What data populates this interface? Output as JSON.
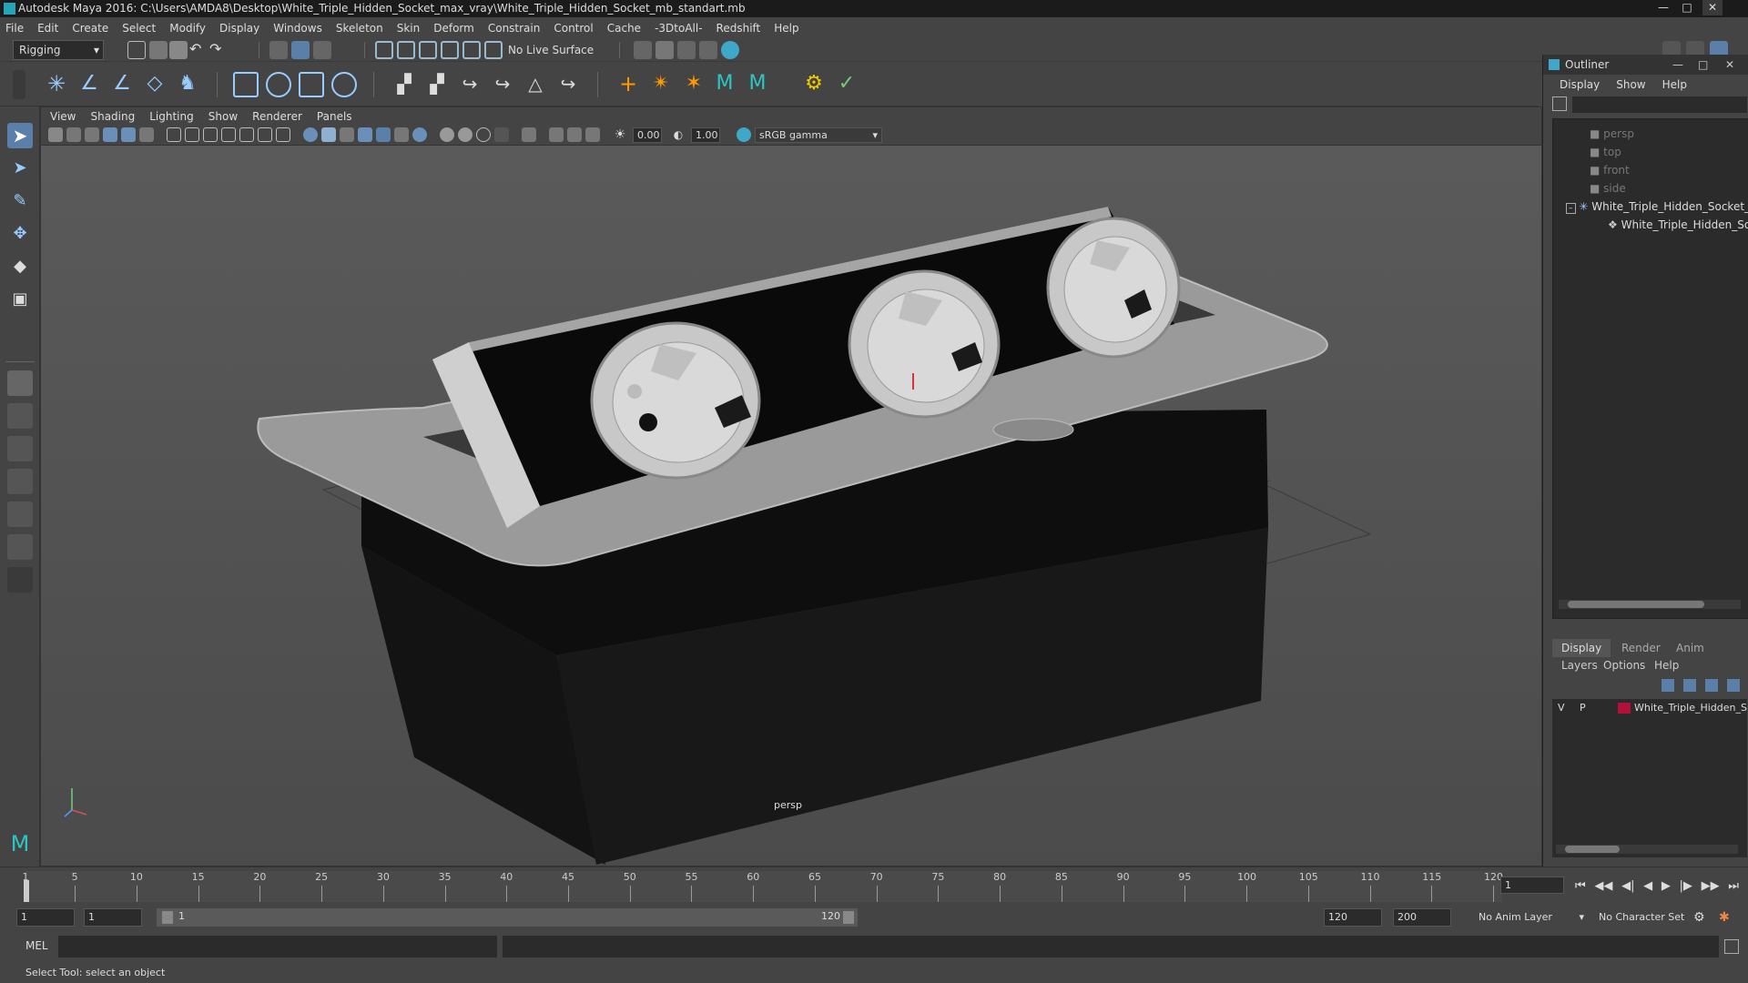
{
  "window": {
    "title": "Autodesk Maya 2016: C:\\Users\\AMDA8\\Desktop\\White_Triple_Hidden_Socket_max_vray\\White_Triple_Hidden_Socket_mb_standart.mb"
  },
  "menubar": [
    "File",
    "Edit",
    "Create",
    "Select",
    "Modify",
    "Display",
    "Windows",
    "Skeleton",
    "Skin",
    "Deform",
    "Constrain",
    "Control",
    "Cache",
    "-3DtoAll-",
    "Redshift",
    "Help"
  ],
  "shelf": {
    "mode": "Rigging",
    "live_surface": "No Live Surface"
  },
  "viewport": {
    "menu": [
      "View",
      "Shading",
      "Lighting",
      "Show",
      "Renderer",
      "Panels"
    ],
    "exposure": "0.00",
    "gamma": "1.00",
    "color_space": "sRGB gamma",
    "camera_label": "persp"
  },
  "outliner": {
    "title": "Outliner",
    "menu": [
      "Display",
      "Show",
      "Help"
    ],
    "items": [
      {
        "label": "persp"
      },
      {
        "label": "top"
      },
      {
        "label": "front"
      },
      {
        "label": "side"
      },
      {
        "label": "White_Triple_Hidden_Socket_"
      },
      {
        "label": "White_Triple_Hidden_Soc"
      }
    ]
  },
  "layers": {
    "tabs": [
      "Display",
      "Render",
      "Anim"
    ],
    "menu": [
      "Layers",
      "Options",
      "Help"
    ],
    "row": {
      "v": "V",
      "p": "P",
      "name": "White_Triple_Hidden_S",
      "color": "#b0103a"
    }
  },
  "timeline": {
    "ticks": [
      "1",
      "5",
      "10",
      "15",
      "20",
      "25",
      "30",
      "35",
      "40",
      "45",
      "50",
      "55",
      "60",
      "65",
      "70",
      "75",
      "80",
      "85",
      "90",
      "95",
      "100",
      "105",
      "110",
      "115",
      "120"
    ],
    "current_frame": "1"
  },
  "range": {
    "start": "1",
    "start2": "1",
    "slider_start": "1",
    "slider_end": "120",
    "end": "120",
    "max": "200",
    "anim_layer": "No Anim Layer",
    "char_set": "No Character Set"
  },
  "command": {
    "label": "MEL"
  },
  "help": {
    "text": "Select Tool: select an object"
  }
}
